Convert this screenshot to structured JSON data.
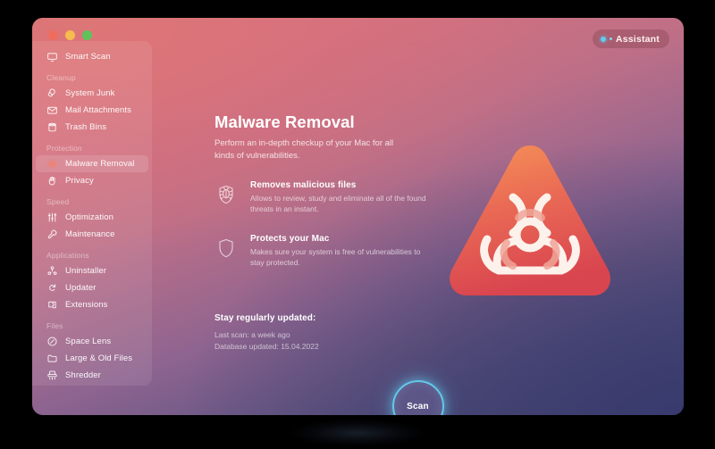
{
  "window": {
    "traffic_lights": [
      {
        "name": "close",
        "color": "#ef6d5e"
      },
      {
        "name": "minimize",
        "color": "#f5bd4e"
      },
      {
        "name": "zoom",
        "color": "#5ec45a"
      }
    ]
  },
  "assistant": {
    "label": "Assistant",
    "dot_color": "#5ecbf0"
  },
  "sidebar": {
    "groups": [
      {
        "label": "",
        "items": [
          {
            "label": "Smart Scan",
            "icon": "monitor-icon",
            "selected": false
          }
        ]
      },
      {
        "label": "Cleanup",
        "items": [
          {
            "label": "System Junk",
            "icon": "broom-icon",
            "selected": false
          },
          {
            "label": "Mail Attachments",
            "icon": "envelope-icon",
            "selected": false
          },
          {
            "label": "Trash Bins",
            "icon": "trash-bin-icon",
            "selected": false
          }
        ]
      },
      {
        "label": "Protection",
        "items": [
          {
            "label": "Malware Removal",
            "icon": "biohazard-icon",
            "selected": true
          },
          {
            "label": "Privacy",
            "icon": "hand-icon",
            "selected": false
          }
        ]
      },
      {
        "label": "Speed",
        "items": [
          {
            "label": "Optimization",
            "icon": "sliders-icon",
            "selected": false
          },
          {
            "label": "Maintenance",
            "icon": "wrench-icon",
            "selected": false
          }
        ]
      },
      {
        "label": "Applications",
        "items": [
          {
            "label": "Uninstaller",
            "icon": "app-grid-icon",
            "selected": false
          },
          {
            "label": "Updater",
            "icon": "refresh-icon",
            "selected": false
          },
          {
            "label": "Extensions",
            "icon": "puzzle-icon",
            "selected": false
          }
        ]
      },
      {
        "label": "Files",
        "items": [
          {
            "label": "Space Lens",
            "icon": "lens-icon",
            "selected": false
          },
          {
            "label": "Large & Old Files",
            "icon": "folder-icon",
            "selected": false
          },
          {
            "label": "Shredder",
            "icon": "shredder-icon",
            "selected": false
          }
        ]
      }
    ]
  },
  "main": {
    "title": "Malware Removal",
    "subtitle": "Perform an in-depth checkup of your Mac for all kinds of vulnerabilities.",
    "features": [
      {
        "icon": "bug-shield-icon",
        "title": "Removes malicious files",
        "description": "Allows to review, study and eliminate all of the found threats in an instant."
      },
      {
        "icon": "shield-icon",
        "title": "Protects your Mac",
        "description": "Makes sure your system is free of vulnerabilities to stay protected."
      }
    ],
    "updated": {
      "title": "Stay regularly updated:",
      "last_scan": "Last scan: a week ago",
      "database_updated": "Database updated: 15.04.2022"
    },
    "hero_icon": "biohazard-triangle-icon",
    "scan_button_label": "Scan"
  },
  "colors": {
    "accent_scan": "#64c8ea",
    "logo_gradient_start": "#f08a56",
    "logo_gradient_end": "#dd4f52",
    "background_top": "#d9737d",
    "background_bottom": "#42406d"
  }
}
